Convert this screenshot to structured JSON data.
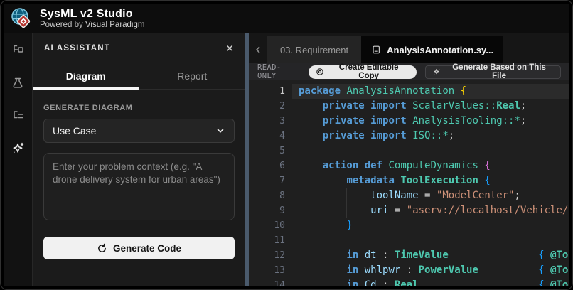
{
  "header": {
    "title": "SysML v2 Studio",
    "subtitle_prefix": "Powered by ",
    "subtitle_link": "Visual Paradigm"
  },
  "sidebar": {
    "icons": [
      {
        "name": "type-hierarchy-icon",
        "active": false
      },
      {
        "name": "flask-icon",
        "active": false
      },
      {
        "name": "list-tree-icon",
        "active": false
      },
      {
        "name": "ai-sparkle-icon",
        "active": true
      }
    ]
  },
  "ai_panel": {
    "title": "AI ASSISTANT",
    "close_glyph": "✕",
    "tabs": [
      {
        "label": "Diagram",
        "active": true
      },
      {
        "label": "Report",
        "active": false
      }
    ],
    "generate": {
      "section_label": "GENERATE DIAGRAM",
      "selected_diagram": "Use Case",
      "placeholder": "Enter your problem context (e.g. \"A drone delivery system for urban areas\")",
      "button_label": "Generate Code"
    }
  },
  "editor": {
    "scroll_left_glyph": "‹",
    "tabs": [
      {
        "label": "03. Requirement",
        "active": false
      },
      {
        "label": "AnalysisAnnotation.sy...",
        "active": true,
        "icon": "document-icon"
      }
    ],
    "toolbar": {
      "readonly_label": "READ-ONLY",
      "create_copy_button": "Create Editable Copy",
      "generate_file_button": "Generate Based on This File"
    },
    "colors": {
      "divider_accent": "#4A5A6C",
      "keyword": "#569CD6",
      "type": "#4EC9B0",
      "variable": "#9CDCFE",
      "string": "#CE9178",
      "bracket_level1": "#FFD700",
      "bracket_level2": "#D670D6",
      "bracket_level3": "#179FFF"
    },
    "code_lines": [
      {
        "n": 1,
        "active": true,
        "tokens": [
          [
            "kw",
            "package"
          ],
          [
            "pl",
            " "
          ],
          [
            "ty",
            "AnalysisAnnotation"
          ],
          [
            "pl",
            " "
          ],
          [
            "b1",
            "{"
          ]
        ]
      },
      {
        "n": 2,
        "tokens": [
          [
            "pl",
            "    "
          ],
          [
            "kw",
            "private"
          ],
          [
            "pl",
            " "
          ],
          [
            "kw",
            "import"
          ],
          [
            "pl",
            " "
          ],
          [
            "ty",
            "ScalarValues::"
          ],
          [
            "tyb",
            "Real"
          ],
          [
            "pun",
            ";"
          ]
        ]
      },
      {
        "n": 3,
        "tokens": [
          [
            "pl",
            "    "
          ],
          [
            "kw",
            "private"
          ],
          [
            "pl",
            " "
          ],
          [
            "kw",
            "import"
          ],
          [
            "pl",
            " "
          ],
          [
            "ty",
            "AnalysisTooling::*"
          ],
          [
            "pun",
            ";"
          ]
        ]
      },
      {
        "n": 4,
        "tokens": [
          [
            "pl",
            "    "
          ],
          [
            "kw",
            "private"
          ],
          [
            "pl",
            " "
          ],
          [
            "kw",
            "import"
          ],
          [
            "pl",
            " "
          ],
          [
            "ty",
            "ISQ::*"
          ],
          [
            "pun",
            ";"
          ]
        ]
      },
      {
        "n": 5,
        "tokens": []
      },
      {
        "n": 6,
        "tokens": [
          [
            "pl",
            "    "
          ],
          [
            "kw",
            "action"
          ],
          [
            "pl",
            " "
          ],
          [
            "kw",
            "def"
          ],
          [
            "pl",
            " "
          ],
          [
            "ty",
            "ComputeDynamics"
          ],
          [
            "pl",
            " "
          ],
          [
            "b2",
            "{"
          ]
        ]
      },
      {
        "n": 7,
        "tokens": [
          [
            "pl",
            "        "
          ],
          [
            "kw",
            "metadata"
          ],
          [
            "pl",
            " "
          ],
          [
            "tyb",
            "ToolExecution"
          ],
          [
            "pl",
            " "
          ],
          [
            "b3",
            "{"
          ]
        ]
      },
      {
        "n": 8,
        "tokens": [
          [
            "pl",
            "            "
          ],
          [
            "var",
            "toolName"
          ],
          [
            "pl",
            " "
          ],
          [
            "pun",
            "="
          ],
          [
            "pl",
            " "
          ],
          [
            "str",
            "\"ModelCenter\""
          ],
          [
            "pun",
            ";"
          ]
        ]
      },
      {
        "n": 9,
        "tokens": [
          [
            "pl",
            "            "
          ],
          [
            "var",
            "uri"
          ],
          [
            "pl",
            " "
          ],
          [
            "pun",
            "="
          ],
          [
            "pl",
            " "
          ],
          [
            "str",
            "\"aserv://localhost/Vehicle/Eng"
          ]
        ]
      },
      {
        "n": 10,
        "tokens": [
          [
            "pl",
            "        "
          ],
          [
            "b3",
            "}"
          ]
        ]
      },
      {
        "n": 11,
        "tokens": []
      },
      {
        "n": 12,
        "tokens": [
          [
            "pl",
            "        "
          ],
          [
            "kw",
            "in"
          ],
          [
            "pl",
            " "
          ],
          [
            "var",
            "dt"
          ],
          [
            "pl",
            " "
          ],
          [
            "pun",
            ":"
          ],
          [
            "pl",
            " "
          ],
          [
            "tyb",
            "TimeValue"
          ],
          [
            "pl",
            "               "
          ],
          [
            "b3",
            "{"
          ],
          [
            "pl",
            " "
          ],
          [
            "meta",
            "@ToolVar"
          ]
        ]
      },
      {
        "n": 13,
        "tokens": [
          [
            "pl",
            "        "
          ],
          [
            "kw",
            "in"
          ],
          [
            "pl",
            " "
          ],
          [
            "var",
            "whlpwr"
          ],
          [
            "pl",
            " "
          ],
          [
            "pun",
            ":"
          ],
          [
            "pl",
            " "
          ],
          [
            "tyb",
            "PowerValue"
          ],
          [
            "pl",
            "          "
          ],
          [
            "b3",
            "{"
          ],
          [
            "pl",
            " "
          ],
          [
            "meta",
            "@ToolVar"
          ]
        ]
      },
      {
        "n": 14,
        "tokens": [
          [
            "pl",
            "        "
          ],
          [
            "kw",
            "in"
          ],
          [
            "pl",
            " "
          ],
          [
            "var",
            "Cd"
          ],
          [
            "pl",
            " "
          ],
          [
            "pun",
            ":"
          ],
          [
            "pl",
            " "
          ],
          [
            "tyb",
            "Real"
          ],
          [
            "pl",
            "                    "
          ],
          [
            "b3",
            "{"
          ],
          [
            "pl",
            " "
          ],
          [
            "meta",
            "@ToolVar"
          ]
        ]
      }
    ]
  }
}
